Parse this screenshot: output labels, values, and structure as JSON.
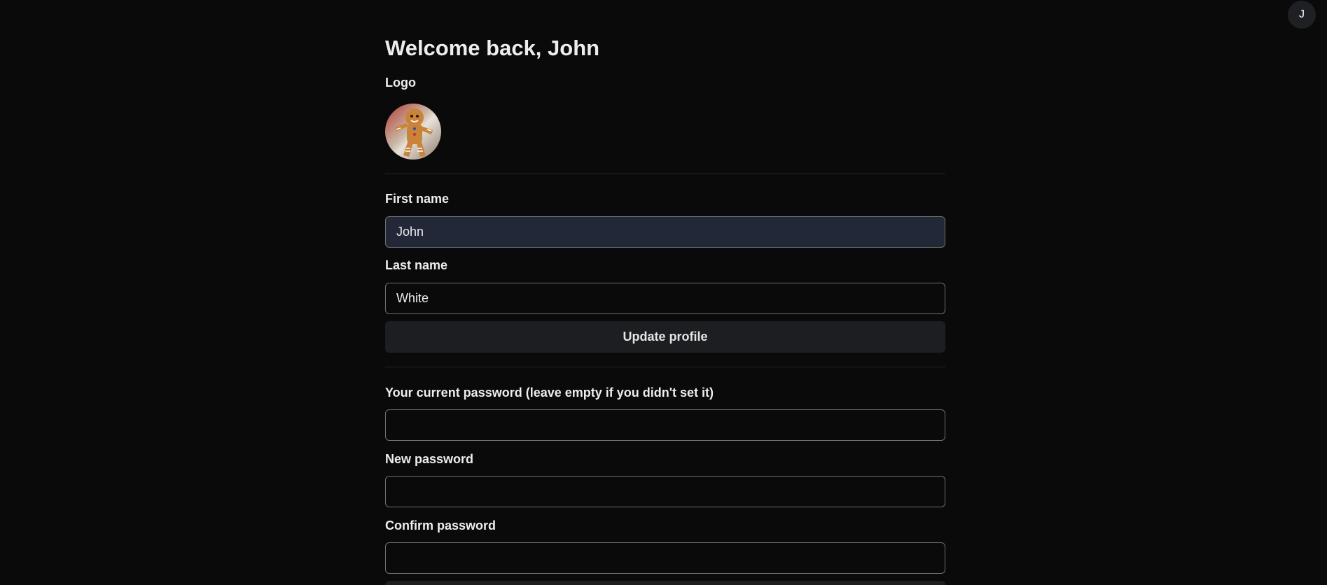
{
  "header": {
    "avatar_initial": "J"
  },
  "profile": {
    "title": "Welcome back, John",
    "logo_label": "Logo",
    "logo_icon": "gingerbread-man-icon",
    "first_name_label": "First name",
    "first_name_value": "John",
    "last_name_label": "Last name",
    "last_name_value": "White",
    "update_button_label": "Update profile"
  },
  "password": {
    "current_label": "Your current password (leave empty if you didn't set it)",
    "current_value": "",
    "new_label": "New password",
    "new_value": "",
    "confirm_label": "Confirm password",
    "confirm_value": ""
  },
  "colors": {
    "background": "#0a0a0a",
    "filled_input": "#232839",
    "button": "#1d1e21",
    "border": "#6f6f6f"
  }
}
